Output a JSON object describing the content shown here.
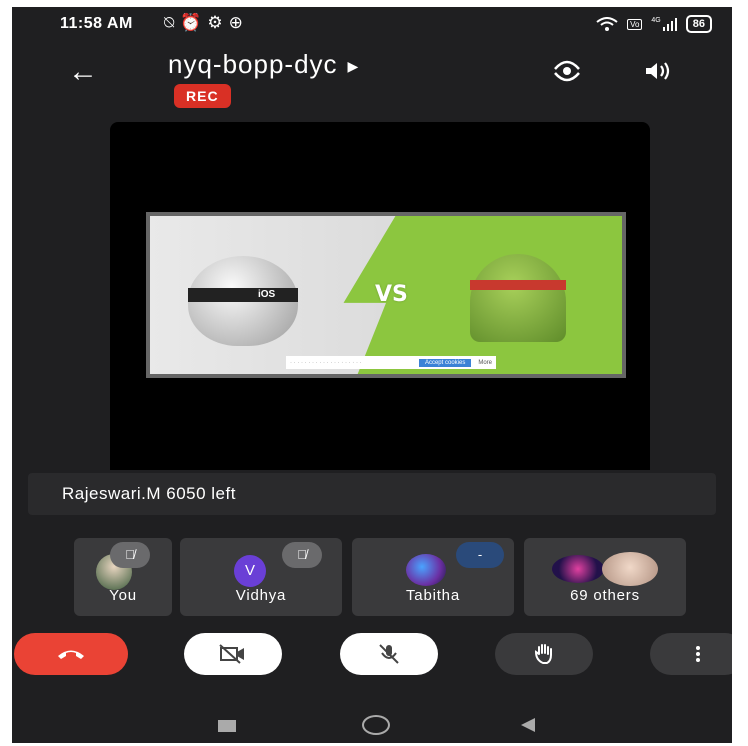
{
  "status_bar": {
    "time": "11:58 AM",
    "battery": "86",
    "network": "4G",
    "icons": [
      "mute-notifications-icon",
      "alarm-icon",
      "settings-gear-icon",
      "game-controller-icon",
      "wifi-icon",
      "volte-icon",
      "signal-icon"
    ]
  },
  "header": {
    "meeting_code": "nyq-bopp-dyc",
    "rec_badge": "REC"
  },
  "slide": {
    "vs_text": "VS",
    "left_logo_text": "iOS",
    "cookie_button": "Accept cookies",
    "cookie_more": "More"
  },
  "toast": {
    "message": "Rajeswari.M 6050 left"
  },
  "participants": [
    {
      "name": "You",
      "muted": true
    },
    {
      "name": "Vidhya",
      "initial": "V",
      "muted": true,
      "avatar_color": "#6a3fd6"
    },
    {
      "name": "Tabitha",
      "muted": false
    },
    {
      "name": "69 others"
    }
  ],
  "controls": [
    "end-call",
    "camera-off",
    "mic-off",
    "raise-hand",
    "more-options"
  ],
  "colors": {
    "background": "#1f1f21",
    "rec": "#d93025",
    "end_call": "#ea4335",
    "tile": "#3a3a3c",
    "android_green": "#8cc63f"
  }
}
